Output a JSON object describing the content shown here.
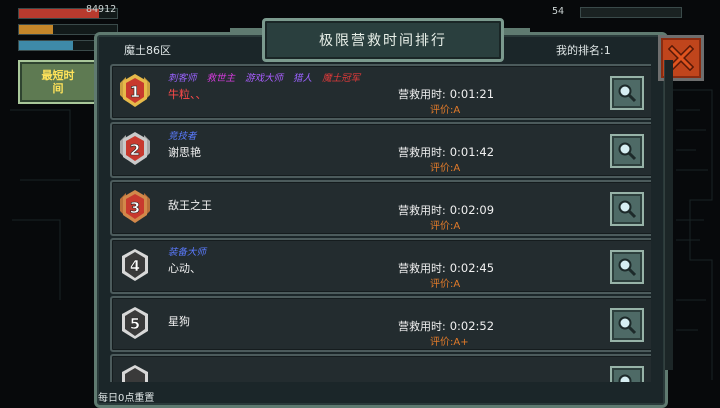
{
  "hud": {
    "gold_value": "84912",
    "level_value": "54",
    "hp_fraction": 0.82,
    "stamina_fraction": 0.35,
    "xp_fraction": 0.55
  },
  "side_tab": {
    "label": "最短时\n间"
  },
  "header": {
    "title": "极限营救时间排行",
    "server": "魔土86区",
    "my_rank": "我的排名:1"
  },
  "rows": [
    {
      "rank": "1",
      "badge": "rank-1-gold-badge",
      "titles": [
        {
          "text": "刺客师",
          "color": "#9b62ff"
        },
        {
          "text": "救世主",
          "color": "#d03bd8"
        },
        {
          "text": "游戏大师",
          "color": "#a95dff"
        },
        {
          "text": "猎人",
          "color": "#9b62ff"
        },
        {
          "text": "魔土冠军",
          "color": "#e03a3a"
        }
      ],
      "name": "牛粒、、",
      "name_color": "#ff4a4a",
      "time_label": "营救用时:",
      "time": "0:01:21",
      "grade_label": "评价:",
      "grade": "A"
    },
    {
      "rank": "2",
      "badge": "rank-2-silver-badge",
      "titles": [
        {
          "text": "竞技者",
          "color": "#5b7bff"
        }
      ],
      "name": "谢思艳",
      "name_color": "#f0f0f0",
      "time_label": "营救用时:",
      "time": "0:01:42",
      "grade_label": "评价:",
      "grade": "A"
    },
    {
      "rank": "3",
      "badge": "rank-3-bronze-badge",
      "titles": [],
      "name": "敌王之王",
      "name_color": "#f0f0f0",
      "time_label": "营救用时:",
      "time": "0:02:09",
      "grade_label": "评价:",
      "grade": "A"
    },
    {
      "rank": "4",
      "badge": "rank-4-plain-badge",
      "titles": [
        {
          "text": "装备大师",
          "color": "#5b7bff"
        }
      ],
      "name": "心动、",
      "name_color": "#f0f0f0",
      "time_label": "营救用时:",
      "time": "0:02:45",
      "grade_label": "评价:",
      "grade": "A"
    },
    {
      "rank": "5",
      "badge": "rank-5-plain-badge",
      "titles": [],
      "name": "星狗",
      "name_color": "#f0f0f0",
      "time_label": "营救用时:",
      "time": "0:02:52",
      "grade_label": "评价:",
      "grade": "A+"
    },
    {
      "rank": "",
      "badge": "rank-6-plain-badge",
      "titles": [],
      "name": "",
      "name_color": "#f0f0f0",
      "time_label": "",
      "time": "",
      "grade_label": "",
      "grade": ""
    }
  ],
  "footer": {
    "reset_note": "每日0点重置"
  },
  "colors": {
    "panel_border": "#5f7a70",
    "row_bg": "#232c2f",
    "grade_orange": "#e07a2a",
    "close_red": "#c0451c"
  }
}
